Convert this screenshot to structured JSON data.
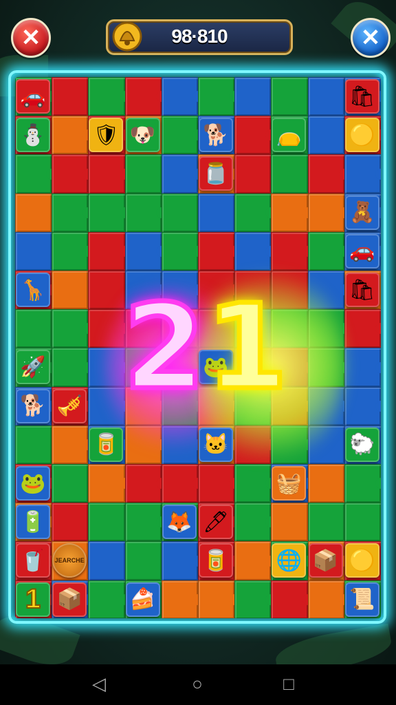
{
  "header": {
    "close_label": "✕",
    "score": "98·810",
    "coin_icon": "coin-bell-icon",
    "exit_label": "✕"
  },
  "board": {
    "countdown_left": "2",
    "countdown_right": "1",
    "tile_value_bottom_left": "1",
    "tile_label_bronze": "JEARCHE",
    "colors": {
      "red": "#d31a1e",
      "green": "#15a33a",
      "blue": "#1f63c9",
      "orange": "#e96e12",
      "frame": "#34e6ff"
    }
  },
  "navigation": {
    "back": "◁",
    "home": "○",
    "recents": "□"
  }
}
